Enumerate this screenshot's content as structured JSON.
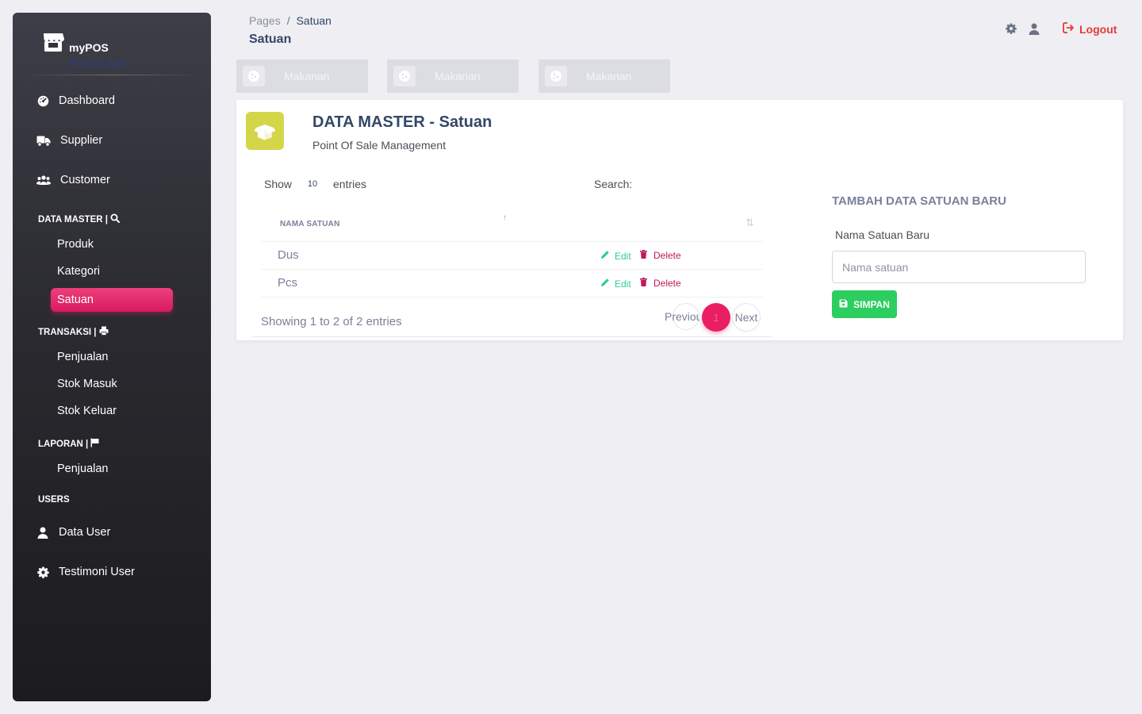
{
  "sidebar": {
    "brand": {
      "name": "myPOS",
      "subtitle": "Point Of Sale"
    },
    "top_items": [
      {
        "label": "Dashboard",
        "icon": "dashboard-icon"
      },
      {
        "label": "Supplier",
        "icon": "truck-icon"
      },
      {
        "label": "Customer",
        "icon": "users-icon"
      }
    ],
    "sections": {
      "data_master": {
        "title": "DATA MASTER |",
        "icon": "search-icon",
        "items": [
          "Produk",
          "Kategori",
          "Satuan"
        ],
        "active": "Satuan"
      },
      "transaksi": {
        "title": "TRANSAKSI |",
        "icon": "printer-icon",
        "items": [
          "Penjualan",
          "Stok Masuk",
          "Stok Keluar"
        ]
      },
      "laporan": {
        "title": "LAPORAN |",
        "icon": "flag-icon",
        "items": [
          "Penjualan"
        ]
      },
      "users": {
        "title": "USERS",
        "items": [
          {
            "label": "Data User",
            "icon": "user-icon"
          },
          {
            "label": "Testimoni User",
            "icon": "gear-icon"
          }
        ]
      }
    }
  },
  "header": {
    "breadcrumb": {
      "root": "Pages",
      "separator": "/",
      "current": "Satuan"
    },
    "title": "Satuan",
    "icons": [
      "settings-icon",
      "user-icon"
    ],
    "logout_label": "Logout"
  },
  "category_cards": [
    {
      "label": "Makanan",
      "icon": "cookie-icon"
    },
    {
      "label": "Makanan",
      "icon": "cookie-icon"
    },
    {
      "label": "Makanan",
      "icon": "cookie-icon"
    }
  ],
  "card": {
    "title": "DATA MASTER - Satuan",
    "subtitle": "Point Of Sale Management",
    "icon": "box-icon",
    "accent_color": "#d4d64a"
  },
  "table": {
    "show_label": "Show",
    "page_size": "10",
    "entries_label": "entries",
    "search_label": "Search:",
    "search_value": "",
    "columns": [
      "NAMA SATUAN",
      ""
    ],
    "rows": [
      {
        "name": "Dus",
        "edit": "Edit",
        "delete": "Delete"
      },
      {
        "name": "Pcs",
        "edit": "Edit",
        "delete": "Delete"
      }
    ],
    "info": "Showing 1 to 2 of 2 entries",
    "pagination": {
      "previous": "Previous",
      "current": "1",
      "next": "Next"
    }
  },
  "form": {
    "title": "TAMBAH DATA SATUAN BARU",
    "label": "Nama Satuan Baru",
    "placeholder": "Nama satuan",
    "value": "",
    "submit_label": "SIMPAN",
    "submit_color": "#2dce60"
  },
  "colors": {
    "primary": "#e91e63",
    "success": "#2dce89",
    "danger": "#e53935"
  }
}
